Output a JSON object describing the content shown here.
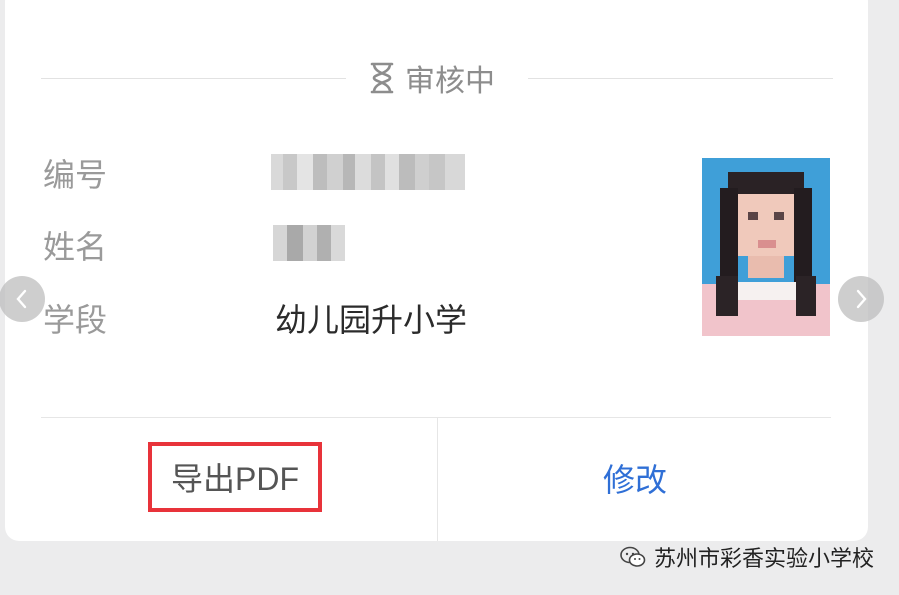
{
  "status": {
    "text": "审核中",
    "icon": "hourglass-icon"
  },
  "fields": [
    {
      "label": "编号"
    },
    {
      "label": "姓名"
    },
    {
      "label": "学段",
      "value": "幼儿园升小学"
    }
  ],
  "actions": {
    "export_label": "导出PDF",
    "edit_label": "修改"
  },
  "watermark": {
    "text": "苏州市彩香实验小学校"
  },
  "colors": {
    "accent_blue": "#2f6fd6",
    "highlight_red": "#e8333a"
  }
}
